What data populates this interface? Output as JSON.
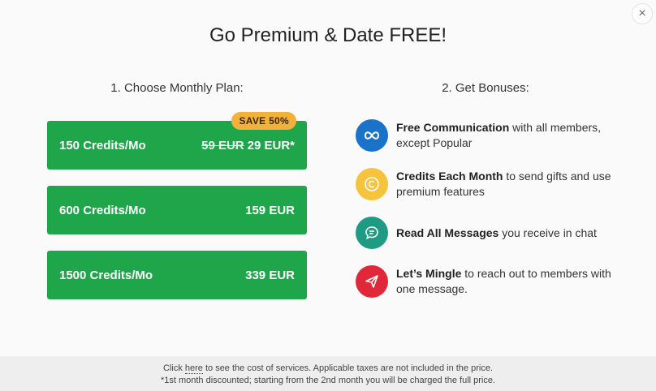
{
  "title": "Go Premium & Date FREE!",
  "close_glyph": "×",
  "left_heading": "1. Choose Monthly Plan:",
  "right_heading": "2. Get Bonuses:",
  "plans": [
    {
      "label": "150 Credits/Mo",
      "old_price": "59 EUR",
      "price": "29 EUR*",
      "badge": "SAVE 50%"
    },
    {
      "label": "600 Credits/Mo",
      "price": "159 EUR"
    },
    {
      "label": "1500 Credits/Mo",
      "price": "339 EUR"
    }
  ],
  "bonuses": [
    {
      "bold": "Free Communication",
      "rest": " with all members, except Popular",
      "icon": "infinity-icon",
      "color": "#1a73c9"
    },
    {
      "bold": "Credits Each Month",
      "rest": " to send gifts and use premium features",
      "icon": "coin-icon",
      "color": "#f6c33c"
    },
    {
      "bold": "Read All Messages",
      "rest": " you receive in chat",
      "icon": "chat-icon",
      "color": "#1f9a83"
    },
    {
      "bold": "Let’s Mingle",
      "rest": " to reach out to members with one message.",
      "icon": "send-icon",
      "color": "#e0283a"
    }
  ],
  "footer": {
    "line1_pre": "Click ",
    "line1_link": "here",
    "line1_post": " to see the cost of services. Applicable taxes are not included in the price.",
    "line2": "*1st month discounted; starting from the 2nd month you will be charged the full price."
  },
  "colors": {
    "plan_green": "#1fa64b",
    "badge_orange": "#f3b13a"
  }
}
